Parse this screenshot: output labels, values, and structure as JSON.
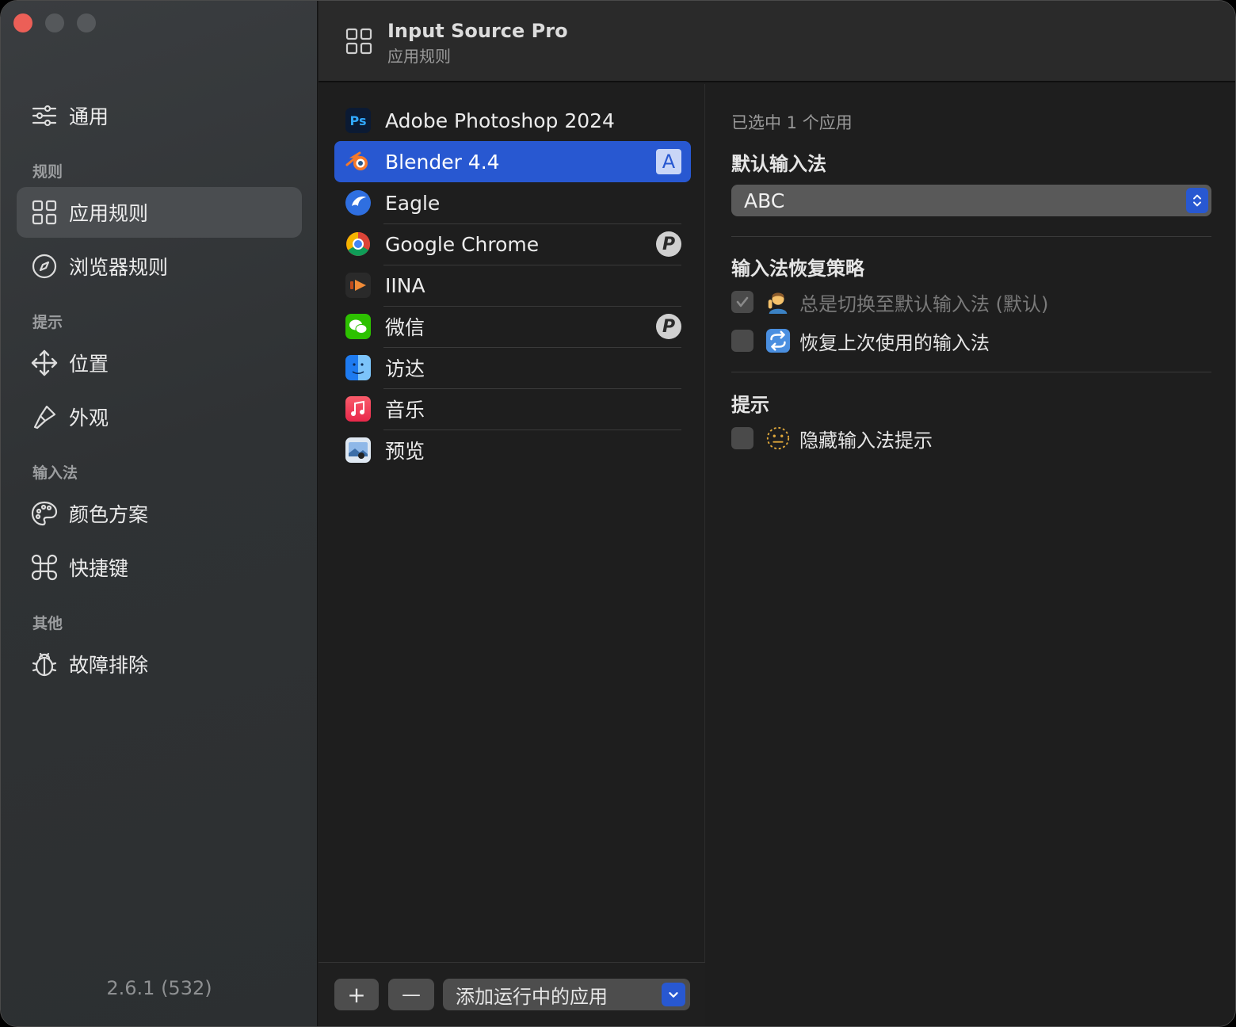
{
  "window": {
    "header": {
      "title": "Input Source Pro",
      "subtitle": "应用规则"
    }
  },
  "sidebar": {
    "general": "通用",
    "sections": {
      "rules": "规则",
      "hints": "提示",
      "input": "输入法",
      "other": "其他"
    },
    "items": {
      "app_rules": "应用规则",
      "browser_rules": "浏览器规则",
      "position": "位置",
      "appearance": "外观",
      "color_scheme": "颜色方案",
      "shortcuts": "快捷键",
      "troubleshoot": "故障排除"
    },
    "version": "2.6.1 (532)"
  },
  "apps": [
    {
      "name": "Adobe Photoshop 2024",
      "icon": "photoshop-icon",
      "badge": ""
    },
    {
      "name": "Blender 4.4",
      "icon": "blender-icon",
      "badge": "A"
    },
    {
      "name": "Eagle",
      "icon": "eagle-icon",
      "badge": ""
    },
    {
      "name": "Google Chrome",
      "icon": "chrome-icon",
      "badge": "P"
    },
    {
      "name": "IINA",
      "icon": "iina-icon",
      "badge": ""
    },
    {
      "name": "微信",
      "icon": "wechat-icon",
      "badge": "P"
    },
    {
      "name": "访达",
      "icon": "finder-icon",
      "badge": ""
    },
    {
      "name": "音乐",
      "icon": "music-icon",
      "badge": ""
    },
    {
      "name": "预览",
      "icon": "preview-icon",
      "badge": ""
    }
  ],
  "list_footer": {
    "add": "+",
    "remove": "—",
    "add_running": "添加运行中的应用"
  },
  "detail": {
    "selected_count": "已选中 1 个应用",
    "default_input_heading": "默认输入法",
    "default_input_value": "ABC",
    "restore_heading": "输入法恢复策略",
    "restore_always": "总是切换至默认输入法 (默认)",
    "restore_last": "恢复上次使用的输入法",
    "hint_heading": "提示",
    "hide_hint": "隐藏输入法提示"
  },
  "colors": {
    "accent": "#2858d1",
    "sidebar_active": "#4a4d50",
    "close": "#ec5f57"
  }
}
